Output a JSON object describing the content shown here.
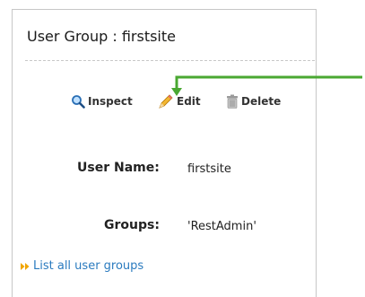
{
  "header": {
    "title": "User Group : firstsite"
  },
  "actions": {
    "inspect_label": "Inspect",
    "edit_label": "Edit",
    "delete_label": "Delete"
  },
  "details": {
    "user_name_label": "User Name:",
    "user_name_value": "firstsite",
    "groups_label": "Groups:",
    "groups_value": "'RestAdmin'"
  },
  "footer": {
    "list_link": "List all user groups"
  },
  "colors": {
    "link": "#2b7bbf",
    "annotation_arrow": "#4aa832",
    "link_arrow_icon": "#f0a500"
  },
  "icons": [
    "magnifier-icon",
    "pencil-icon",
    "trash-can-icon",
    "double-chevron-right-icon"
  ]
}
